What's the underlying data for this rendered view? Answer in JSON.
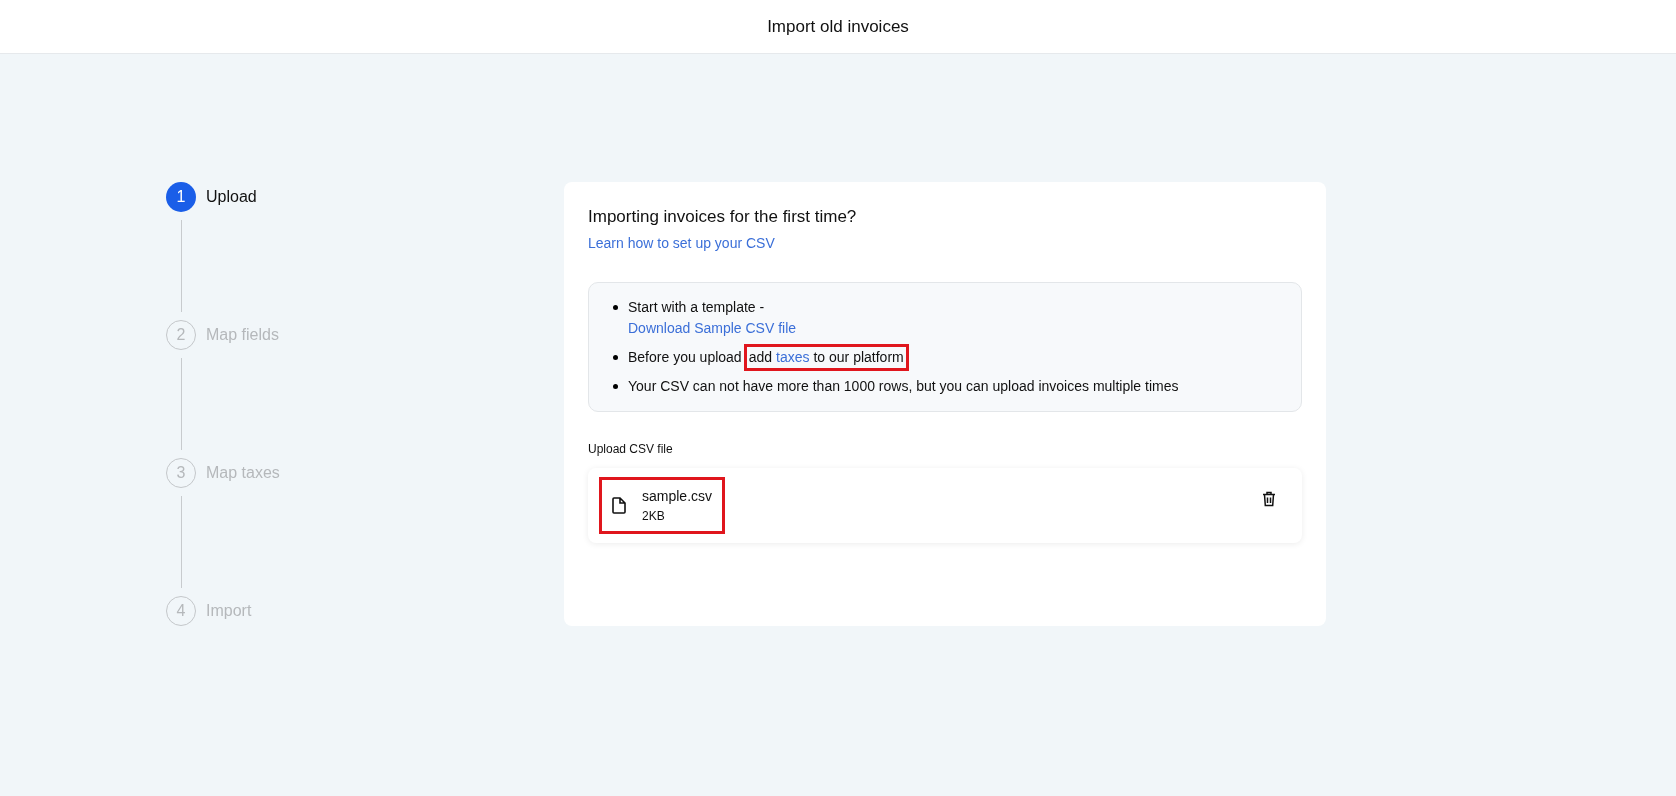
{
  "header": {
    "title": "Import old invoices"
  },
  "steps": [
    {
      "number": "1",
      "label": "Upload",
      "selected": true
    },
    {
      "number": "2",
      "label": "Map fields",
      "selected": false
    },
    {
      "number": "3",
      "label": "Map taxes",
      "selected": false
    },
    {
      "number": "4",
      "label": "Import",
      "selected": false
    }
  ],
  "card": {
    "title": "Importing invoices for the first time?",
    "link": "Learn how to set up your CSV",
    "bullets": [
      {
        "kind": "text_link",
        "text": "Start with a template -",
        "link": "Download Sample CSV file"
      },
      {
        "kind": "inline_link",
        "before": "Before you upload",
        "lead": "add",
        "link": "taxes",
        "after": "to our platform",
        "highlighted": true
      },
      {
        "kind": "text",
        "text": "Your CSV can not have more than 1000 rows, but you can upload invoices multiple times"
      }
    ],
    "upload": {
      "label": "Upload CSV file",
      "file": {
        "name": "sample.csv",
        "size": "2KB",
        "highlighted": true
      }
    }
  }
}
